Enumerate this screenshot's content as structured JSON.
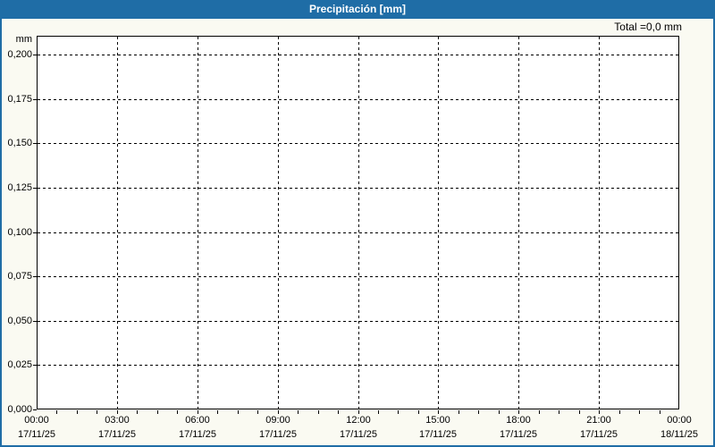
{
  "window": {
    "title": "Precipitación [mm]",
    "colors": {
      "title_bar": "#1f6da6",
      "frame_border": "#1f6da6",
      "background": "#fafaf2",
      "plot_background": "#ffffff",
      "grid": "#000000",
      "text": "#000000",
      "title_text": "#ffffff"
    }
  },
  "chart_data": {
    "type": "line",
    "title": "Precipitación [mm]",
    "total_annotation": "Total =0,0 mm",
    "total_value_mm": 0.0,
    "grid": "dashed",
    "legend": "none",
    "y_axis": {
      "unit": "mm",
      "tick_labels": [
        "0,200",
        "0,175",
        "0,150",
        "0,125",
        "0,100",
        "0,075",
        "0,050",
        "0,025",
        "0,000"
      ],
      "tick_values": [
        0.2,
        0.175,
        0.15,
        0.125,
        0.1,
        0.075,
        0.05,
        0.025,
        0.0
      ],
      "min": 0.0,
      "max_gridline": 0.2,
      "decimal_separator": ","
    },
    "x_axis": {
      "major_ticks": [
        {
          "time": "00:00",
          "date": "17/11/25"
        },
        {
          "time": "03:00",
          "date": "17/11/25"
        },
        {
          "time": "06:00",
          "date": "17/11/25"
        },
        {
          "time": "09:00",
          "date": "17/11/25"
        },
        {
          "time": "12:00",
          "date": "17/11/25"
        },
        {
          "time": "15:00",
          "date": "17/11/25"
        },
        {
          "time": "18:00",
          "date": "17/11/25"
        },
        {
          "time": "21:00",
          "date": "17/11/25"
        },
        {
          "time": "00:00",
          "date": "18/11/25"
        }
      ],
      "minor_ticks_per_major_interval": 4,
      "major_interval_hours": 3
    },
    "series": [
      {
        "name": "Precipitación",
        "points": []
      }
    ]
  }
}
